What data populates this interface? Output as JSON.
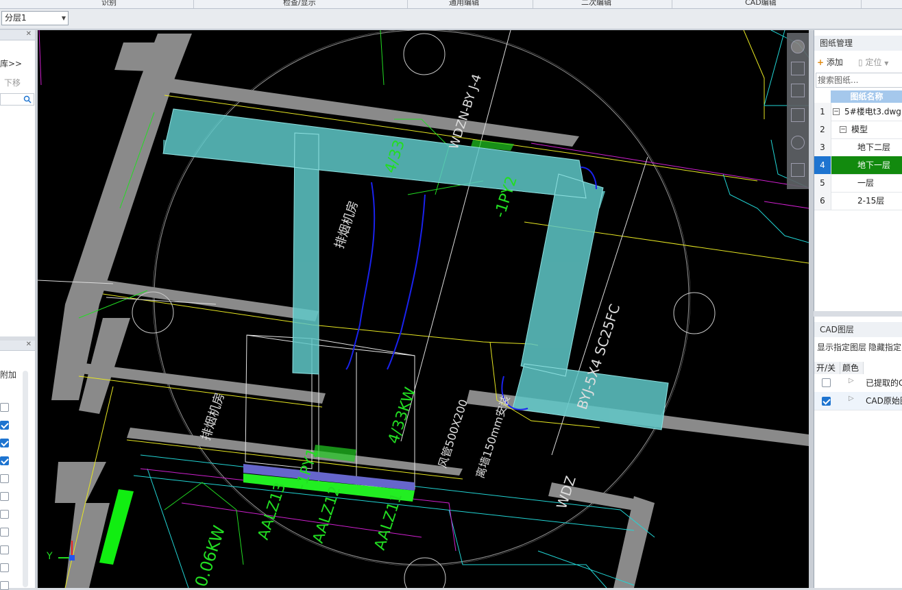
{
  "ribbon": {
    "groups": [
      "识别",
      "检查/显示",
      "通用编辑",
      "二次编辑",
      "CAD编辑"
    ]
  },
  "toolbar": {
    "floor_select": "分层1"
  },
  "left_panel": {
    "library_label": "库>>",
    "move_down_label": "下移",
    "attach_label": "附加",
    "checkboxes": [
      false,
      true,
      true,
      true,
      false,
      false,
      false,
      false,
      false,
      false,
      false
    ]
  },
  "canvas": {
    "labels": {
      "duct_label_1": "WDZN-BY J-4",
      "duct_label_2": "4/33",
      "duct_label_3": "-1PY2",
      "duct_label_4": "-1PY1",
      "duct_label_5": "4/33KW",
      "duct_label_6": "BYJ-5X4 SC25FC",
      "duct_label_7": "WDZ",
      "duct_label_8": "风管500X200",
      "duct_label_9": "离墙150mm安装",
      "room_label_1": "排烟机房",
      "room_label_2": "排烟机房",
      "equip_1": "AALZ13",
      "equip_2": "AALZ12",
      "equip_3": "AALZ11",
      "power": "0.06KW",
      "axis_y": "Y"
    }
  },
  "drawing_panel": {
    "title": "图纸管理",
    "add_label": "添加",
    "locate_label": "定位",
    "search_placeholder": "搜索图纸...",
    "column_header": "图纸名称",
    "rows": [
      {
        "num": "1",
        "label": "5#楼电t3.dwg",
        "toggle": "−"
      },
      {
        "num": "2",
        "label": "模型",
        "toggle": "−"
      },
      {
        "num": "3",
        "label": "地下二层"
      },
      {
        "num": "4",
        "label": "地下一层"
      },
      {
        "num": "5",
        "label": "一层"
      },
      {
        "num": "6",
        "label": "2-15层"
      }
    ],
    "selected_row": 4
  },
  "cad_panel": {
    "title": "CAD图层",
    "show_label": "显示指定图层",
    "hide_label": "隐藏指定",
    "col_onoff": "开/关",
    "col_color": "颜色",
    "rows": [
      {
        "label": "已提取的C",
        "checked": false
      },
      {
        "label": "CAD原始图",
        "checked": true
      }
    ]
  },
  "colors": {
    "duct": "#5fc8c8",
    "selected_row": "#128a0e",
    "wall": "#8a8a8a"
  }
}
